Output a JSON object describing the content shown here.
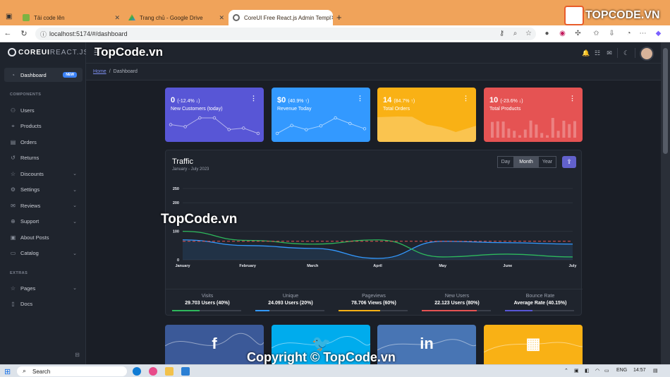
{
  "browser": {
    "tabs": [
      {
        "title": "Tải code lên"
      },
      {
        "title": "Trang chủ - Google Drive"
      },
      {
        "title": "CoreUI Free React.js Admin Templ"
      }
    ],
    "url": "localhost:5174/#/dashboard"
  },
  "watermarks": {
    "brand": "TOPCODE.VN",
    "header": "TopCode.vn",
    "center": "TopCode.vn",
    "footer": "Copyright © TopCode.vn"
  },
  "app": {
    "brand_bold": "COREUI",
    "brand_light": "REACT.JS"
  },
  "sidebar": {
    "dashboard": {
      "label": "Dashboard",
      "badge": "NEW"
    },
    "components_title": "COMPONENTS",
    "items": [
      {
        "label": "Users",
        "icon": "user-icon",
        "chevron": false
      },
      {
        "label": "Products",
        "icon": "tag-icon",
        "chevron": false
      },
      {
        "label": "Orders",
        "icon": "file-icon",
        "chevron": false
      },
      {
        "label": "Returns",
        "icon": "return-icon",
        "chevron": false
      },
      {
        "label": "Discounts",
        "icon": "star-icon",
        "chevron": true
      },
      {
        "label": "Settings",
        "icon": "gear-icon",
        "chevron": true
      },
      {
        "label": "Reviews",
        "icon": "chat-icon",
        "chevron": true
      },
      {
        "label": "Support",
        "icon": "support-icon",
        "chevron": true
      },
      {
        "label": "About Posts",
        "icon": "post-icon",
        "chevron": false
      },
      {
        "label": "Catalog",
        "icon": "folder-icon",
        "chevron": true
      }
    ],
    "extras_title": "EXTRAS",
    "extras": [
      {
        "label": "Pages",
        "icon": "star-icon",
        "chevron": true
      },
      {
        "label": "Docs",
        "icon": "doc-icon",
        "chevron": false
      }
    ]
  },
  "breadcrumb": {
    "home": "Home",
    "separator": "/",
    "current": "Dashboard"
  },
  "widgets": [
    {
      "value": "0",
      "change": "(-12.4% ↓)",
      "label": "New Customers (today)",
      "color": "#5856d6",
      "line": [
        65,
        59,
        84,
        84,
        51,
        55,
        40
      ]
    },
    {
      "value": "$0",
      "change": "(40.9% ↑)",
      "label": "Revenue Today",
      "color": "#3399ff",
      "line": [
        1,
        18,
        9,
        17,
        34,
        22,
        11
      ]
    },
    {
      "value": "14",
      "change": "(84.7% ↑)",
      "label": "Total Orders",
      "color": "#f9b115",
      "line": [
        78,
        81,
        80,
        45,
        34,
        12,
        40
      ]
    },
    {
      "value": "10",
      "change": "(-23.6% ↓)",
      "label": "Total Products",
      "color": "#e55353",
      "bars": [
        78,
        81,
        80,
        45,
        34,
        12,
        40,
        85,
        65,
        23,
        12,
        98,
        34,
        84,
        67,
        82
      ]
    }
  ],
  "traffic": {
    "title": "Traffic",
    "subtitle": "January - July 2023",
    "periods": [
      "Day",
      "Month",
      "Year"
    ],
    "active_period": "Month",
    "stats": [
      {
        "label": "Visits",
        "value": "29.703 Users (40%)",
        "percent": 40,
        "color": "#2eb85c"
      },
      {
        "label": "Unique",
        "value": "24.093 Users (20%)",
        "percent": 20,
        "color": "#3399ff"
      },
      {
        "label": "Pageviews",
        "value": "78.706 Views (60%)",
        "percent": 60,
        "color": "#f9b115"
      },
      {
        "label": "New Users",
        "value": "22.123 Users (80%)",
        "percent": 80,
        "color": "#e55353"
      },
      {
        "label": "Bounce Rate",
        "value": "Average Rate (40.15%)",
        "percent": 40,
        "color": "#5856d6"
      }
    ]
  },
  "chart_data": {
    "type": "line",
    "categories": [
      "January",
      "February",
      "March",
      "April",
      "May",
      "June",
      "July"
    ],
    "yticks": [
      "250",
      "200",
      "100",
      "0"
    ],
    "ylim": [
      0,
      250
    ],
    "series": [
      {
        "color": "#3399ff",
        "values": [
          70,
          50,
          40,
          5,
          65,
          60,
          55
        ],
        "fill": true
      },
      {
        "color": "#2eb85c",
        "values": [
          100,
          68,
          55,
          70,
          10,
          20,
          10
        ],
        "fill": false
      },
      {
        "color": "#e55353",
        "values": [
          65,
          65,
          65,
          65,
          65,
          65,
          65
        ],
        "dashed": true
      }
    ],
    "grid": true
  },
  "social": [
    {
      "icon": "facebook-icon",
      "glyph": "f",
      "color": "#3b5998"
    },
    {
      "icon": "twitter-icon",
      "glyph": "🐦",
      "color": "#00aced"
    },
    {
      "icon": "linkedin-icon",
      "glyph": "in",
      "color": "#4875b4"
    },
    {
      "icon": "calendar-icon",
      "glyph": "▦",
      "color": "#f9b115"
    }
  ],
  "taskbar": {
    "search_placeholder": "Search",
    "lang": "ENG",
    "time": "14:57"
  }
}
